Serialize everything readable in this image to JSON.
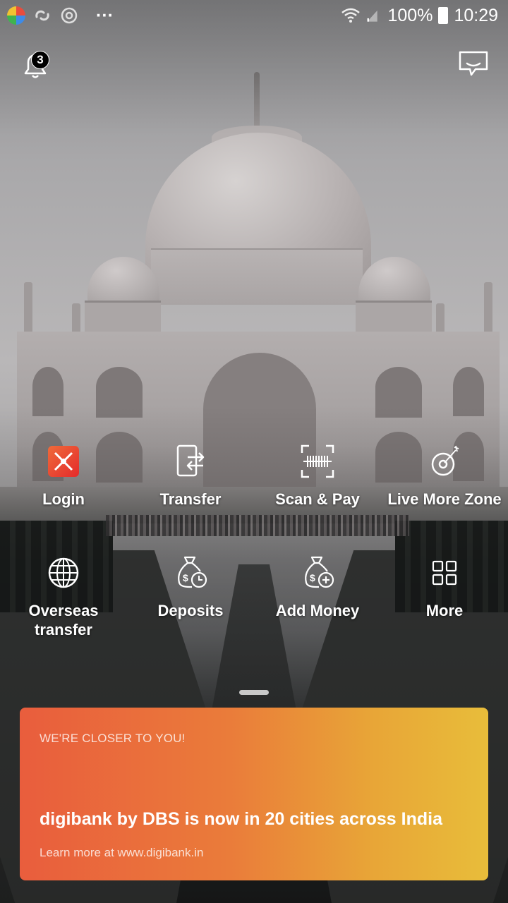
{
  "status_bar": {
    "battery": "100%",
    "time": "10:29",
    "overflow": "···",
    "icons": [
      "app-launcher-icon",
      "link-icon",
      "target-icon",
      "wifi-icon",
      "signal-icon",
      "battery-icon"
    ]
  },
  "header": {
    "notification_count": "3",
    "icons": [
      "bell-icon",
      "chat-icon"
    ]
  },
  "actions": [
    {
      "label": "Login",
      "icon": "dbs-logo-icon"
    },
    {
      "label": "Transfer",
      "icon": "phone-transfer-icon"
    },
    {
      "label": "Scan & Pay",
      "icon": "barcode-scan-icon"
    },
    {
      "label": "Live More Zone",
      "icon": "target-dart-icon"
    },
    {
      "label": "Overseas\ntransfer",
      "icon": "globe-icon"
    },
    {
      "label": "Deposits",
      "icon": "moneybag-clock-icon"
    },
    {
      "label": "Add Money",
      "icon": "moneybag-plus-icon"
    },
    {
      "label": "More",
      "icon": "grid-icon"
    }
  ],
  "promo": {
    "eyebrow": "WE'RE CLOSER TO YOU!",
    "headline": "digibank by DBS is now in 20 cities across India",
    "link": "Learn more at www.digibank.in"
  },
  "colors": {
    "promo_start": "#e95d3d",
    "promo_end": "#e8bd3a",
    "logo_red": "#e42b2b"
  }
}
